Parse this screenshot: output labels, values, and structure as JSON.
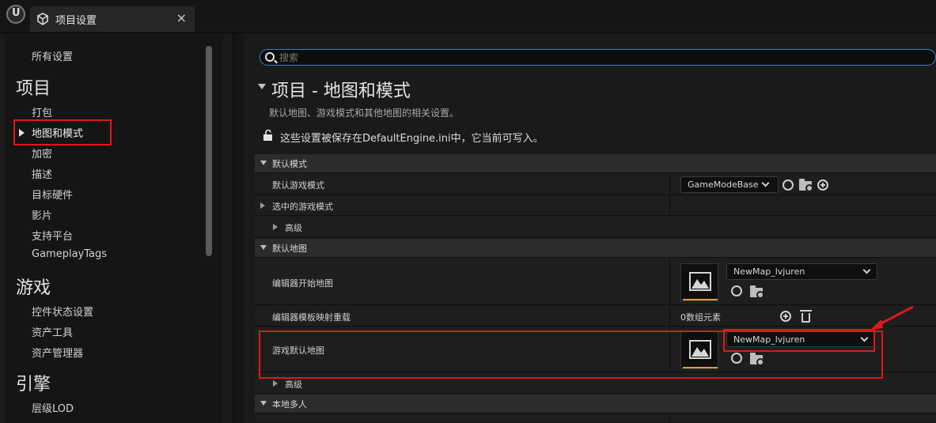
{
  "window": {
    "tab_title": "项目设置",
    "tab_close": "×"
  },
  "sidebar": {
    "all_settings": "所有设置",
    "sections": [
      {
        "title": "项目",
        "items": [
          "打包",
          "地图和模式",
          "加密",
          "描述",
          "目标硬件",
          "影片",
          "支持平台",
          "GameplayTags"
        ]
      },
      {
        "title": "游戏",
        "items": [
          "控件状态设置",
          "资产工具",
          "资产管理器"
        ]
      },
      {
        "title": "引擎",
        "items": [
          "层级LOD"
        ]
      }
    ],
    "selected": "地图和模式"
  },
  "search": {
    "placeholder": "搜索",
    "value": ""
  },
  "page": {
    "title": "项目 - 地图和模式",
    "description": "默认地图、游戏模式和其他地图的相关设置。",
    "save_note": "这些设置被保存在DefaultEngine.ini中，它当前可写入。"
  },
  "categories": {
    "default_modes": "默认模式",
    "default_maps": "默认地图",
    "local_multiplayer": "本地多人"
  },
  "rows": {
    "default_game_mode": {
      "label": "默认游戏模式",
      "value": "GameModeBase"
    },
    "selected_game_mode": {
      "label": "选中的游戏模式"
    },
    "advanced_1": {
      "label": "高级"
    },
    "editor_startup_map": {
      "label": "编辑器开始地图",
      "value": "NewMap_lvjuren"
    },
    "editor_template_override": {
      "label": "编辑器模板映射重载",
      "value": "0数组元素"
    },
    "game_default_map": {
      "label": "游戏默认地图",
      "value": "NewMap_lvjuren"
    },
    "advanced_2": {
      "label": "高级"
    }
  },
  "colors": {
    "annotation": "#e01818",
    "search_border": "#3d7cc9",
    "thumbnail_accent": "#e0a030"
  }
}
